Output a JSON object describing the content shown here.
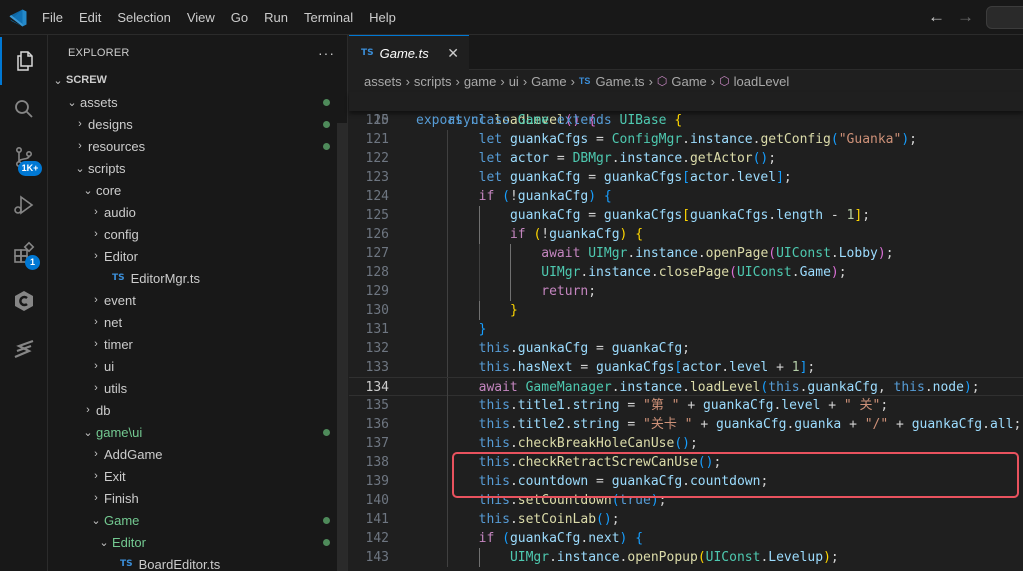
{
  "menu": [
    "File",
    "Edit",
    "Selection",
    "View",
    "Go",
    "Run",
    "Terminal",
    "Help"
  ],
  "activity": {
    "source_control_badge": "1K+",
    "extensions_badge": "1"
  },
  "explorer": {
    "title": "EXPLORER",
    "more": "···",
    "project": "SCREW",
    "items": [
      {
        "label": "assets",
        "chev": "⌄",
        "dot": true
      },
      {
        "label": "designs",
        "chev": "›",
        "dot": true
      },
      {
        "label": "resources",
        "chev": "›",
        "dot": true
      },
      {
        "label": "scripts",
        "chev": "⌄",
        "dot": false
      },
      {
        "label": "core",
        "chev": "⌄"
      },
      {
        "label": "audio",
        "chev": "›"
      },
      {
        "label": "config",
        "chev": "›"
      },
      {
        "label": "Editor",
        "chev": "›"
      },
      {
        "label": "EditorMgr.ts",
        "icon": "TS"
      },
      {
        "label": "event",
        "chev": "›"
      },
      {
        "label": "net",
        "chev": "›"
      },
      {
        "label": "timer",
        "chev": "›"
      },
      {
        "label": "ui",
        "chev": "›"
      },
      {
        "label": "utils",
        "chev": "›"
      },
      {
        "label": "db",
        "chev": "›"
      },
      {
        "label": "game\\ui",
        "chev": "⌄",
        "dot": true
      },
      {
        "label": "AddGame",
        "chev": "›"
      },
      {
        "label": "Exit",
        "chev": "›"
      },
      {
        "label": "Finish",
        "chev": "›"
      },
      {
        "label": "Game",
        "chev": "⌄",
        "dot": true
      },
      {
        "label": "Editor",
        "chev": "⌄",
        "dot": true
      },
      {
        "label": "BoardEditor.ts",
        "icon": "TS"
      }
    ]
  },
  "tab": {
    "icon": "TS",
    "name": "Game.ts",
    "close": "✕"
  },
  "breadcrumb": {
    "parts": [
      "assets",
      "scripts",
      "game",
      "ui",
      "Game"
    ],
    "file_icon": "TS",
    "file": "Game.ts",
    "class_name": "Game",
    "method": "loadLevel"
  },
  "code": {
    "sticky_ln": "15",
    "lines": [
      {
        "ln": "120",
        "indent": 1
      },
      {
        "ln": "121",
        "indent": 2
      },
      {
        "ln": "122",
        "indent": 2
      },
      {
        "ln": "123",
        "indent": 2
      },
      {
        "ln": "124",
        "indent": 2
      },
      {
        "ln": "125",
        "indent": 3
      },
      {
        "ln": "126",
        "indent": 3
      },
      {
        "ln": "127",
        "indent": 4
      },
      {
        "ln": "128",
        "indent": 4
      },
      {
        "ln": "129",
        "indent": 4
      },
      {
        "ln": "130",
        "indent": 3
      },
      {
        "ln": "131",
        "indent": 2
      },
      {
        "ln": "132",
        "indent": 2
      },
      {
        "ln": "133",
        "indent": 2
      },
      {
        "ln": "134",
        "indent": 2
      },
      {
        "ln": "135",
        "indent": 2
      },
      {
        "ln": "136",
        "indent": 2
      },
      {
        "ln": "137",
        "indent": 2
      },
      {
        "ln": "138",
        "indent": 2
      },
      {
        "ln": "139",
        "indent": 2
      },
      {
        "ln": "140",
        "indent": 2
      },
      {
        "ln": "141",
        "indent": 2
      },
      {
        "ln": "142",
        "indent": 2
      },
      {
        "ln": "143",
        "indent": 3
      }
    ],
    "current_line": "134",
    "strings": {
      "guanka": "\"Guanka\"",
      "di": "\"第 \"",
      "guan": "\" 关\"",
      "guanka_cn": "\"关卡 \"",
      "slash": "\"/\""
    }
  },
  "colors": {
    "accent": "#0078d4",
    "highlight_box": "#e8525e",
    "git_added": "#73c991"
  }
}
